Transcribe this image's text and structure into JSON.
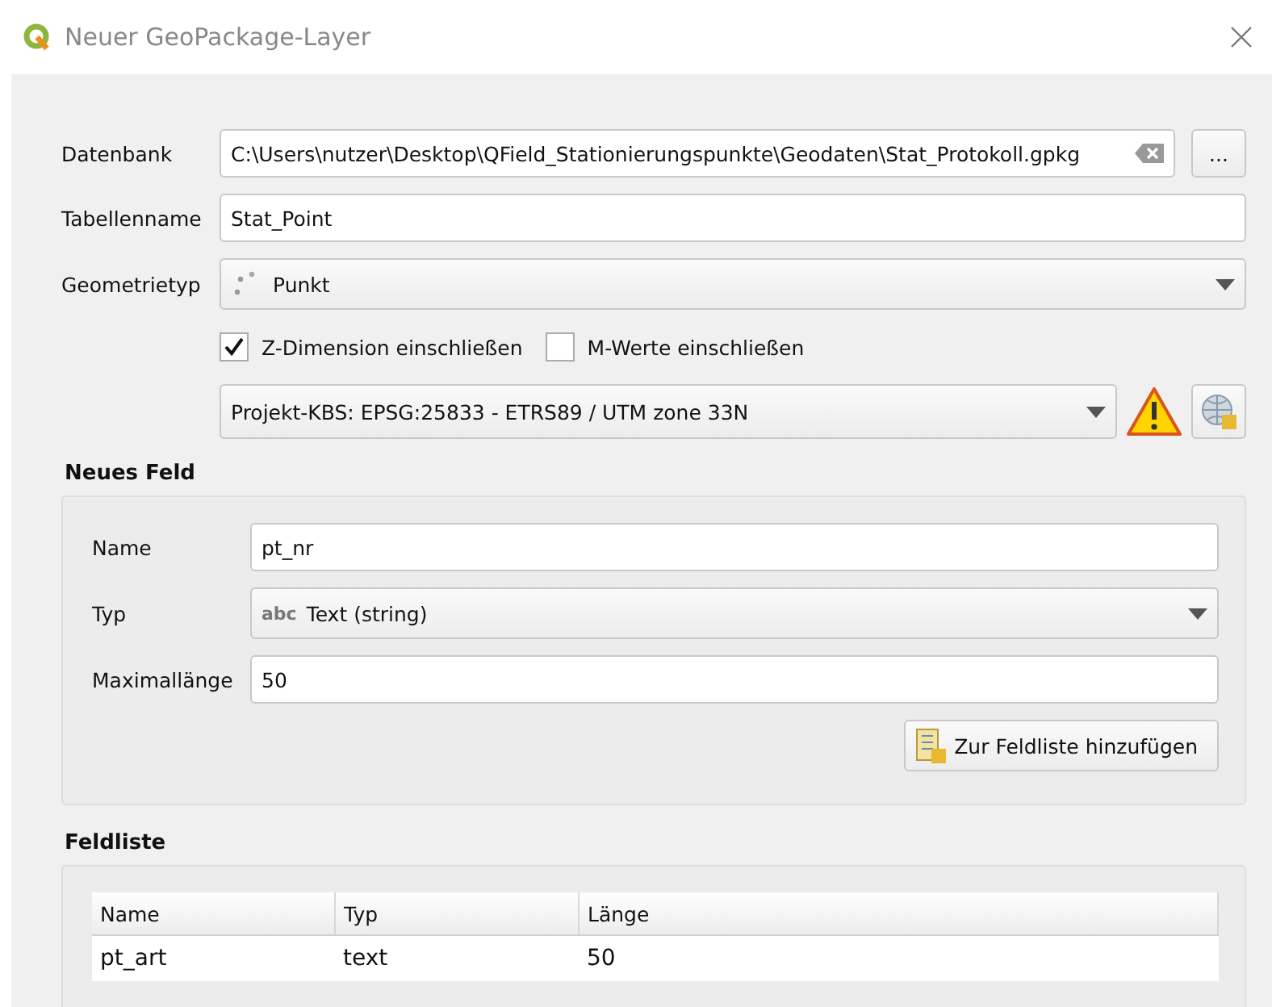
{
  "window": {
    "title": "Neuer GeoPackage-Layer"
  },
  "database": {
    "label": "Datenbank",
    "value": "C:\\Users\\nutzer\\Desktop\\QField_Stationierungspunkte\\Geodaten\\Stat_Protokoll.gpkg",
    "browse": "..."
  },
  "table_name": {
    "label": "Tabellenname",
    "value": "Stat_Point"
  },
  "geometry_type": {
    "label": "Geometrietyp",
    "value": "Punkt"
  },
  "options": [
    {
      "label": "Z-Dimension einschließen",
      "checked": true
    },
    {
      "label": "M-Werte einschließen",
      "checked": false
    }
  ],
  "crs": {
    "value": "Projekt-KBS: EPSG:25833 - ETRS89 / UTM zone 33N"
  },
  "new_field": {
    "title": "Neues Feld",
    "name": {
      "label": "Name",
      "value": "pt_nr"
    },
    "type": {
      "label": "Typ",
      "icon_text": "abc",
      "value": "Text (string)"
    },
    "max_length": {
      "label": "Maximallänge",
      "value": "50"
    },
    "add_button": "Zur Feldliste hinzufügen"
  },
  "field_list": {
    "title": "Feldliste",
    "columns": [
      "Name",
      "Typ",
      "Länge"
    ],
    "rows": [
      {
        "cells": [
          "pt_art",
          "text",
          "50"
        ]
      }
    ]
  }
}
